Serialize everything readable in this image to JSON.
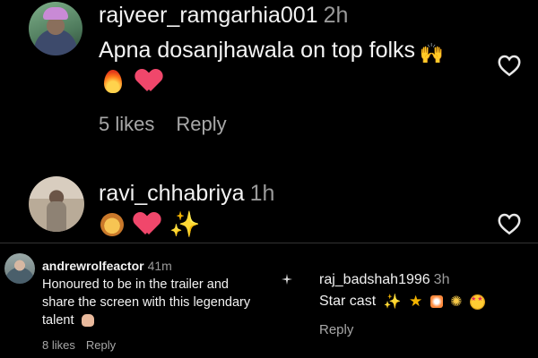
{
  "comments_top": [
    {
      "username": "rajveer_ramgarhia001",
      "time": "2h",
      "text": "Apna dosanjhawala on top folks",
      "likes": "5 likes",
      "reply": "Reply",
      "emojis": [
        "fire",
        "heart"
      ]
    },
    {
      "username": "ravi_chhabriya",
      "time": "1h",
      "emojis": [
        "lion",
        "heart",
        "sparkles"
      ]
    }
  ],
  "comment_bottom_left": {
    "username": "andrewrolfeactor",
    "time": "41m",
    "lines": [
      "Honoured to be in the trailer and",
      "share the screen with this legendary",
      "talent"
    ],
    "likes": "8 likes",
    "reply": "Reply"
  },
  "comment_bottom_right": {
    "username": "raj_badshah1996",
    "time": "3h",
    "text": "Star cast",
    "reply": "Reply"
  },
  "colors": {
    "background": "#000000",
    "text": "#f5f5f5",
    "muted": "#a8a8a8",
    "heart": "#f0476b"
  }
}
